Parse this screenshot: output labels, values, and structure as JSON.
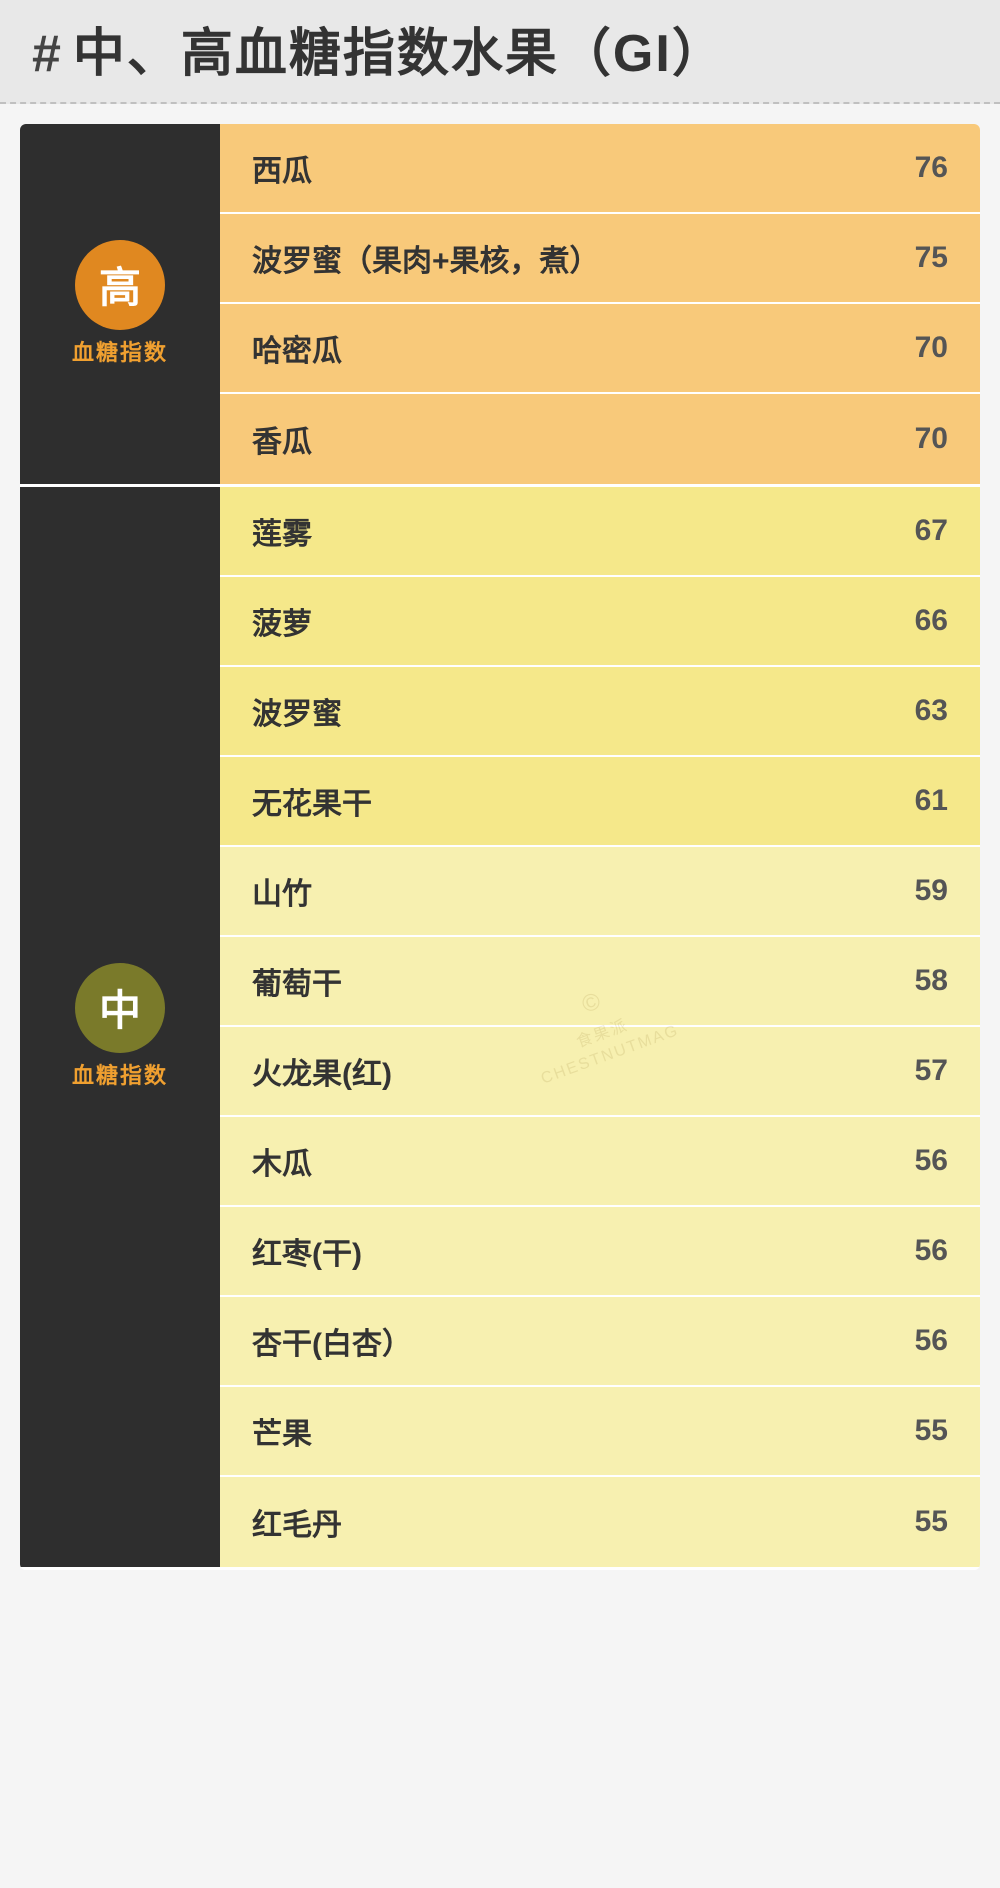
{
  "page": {
    "background": "#f5f5f5"
  },
  "header": {
    "hash": "#",
    "title": "中、高血糖指数水果（GI）"
  },
  "sections": [
    {
      "id": "high",
      "badge_type": "high",
      "badge_char": "高",
      "label": "血糖指数",
      "fruits": [
        {
          "name": "西瓜",
          "value": "76",
          "shade": "high-row"
        },
        {
          "name": "波罗蜜（果肉+果核，煮）",
          "value": "75",
          "shade": "high-row"
        },
        {
          "name": "哈密瓜",
          "value": "70",
          "shade": "high-row"
        },
        {
          "name": "香瓜",
          "value": "70",
          "shade": "high-row"
        }
      ]
    },
    {
      "id": "mid",
      "badge_type": "mid",
      "badge_char": "中",
      "label": "血糖指数",
      "fruits": [
        {
          "name": "莲雾",
          "value": "67",
          "shade": "mid-row-dark"
        },
        {
          "name": "菠萝",
          "value": "66",
          "shade": "mid-row-dark"
        },
        {
          "name": "波罗蜜",
          "value": "63",
          "shade": "mid-row-dark"
        },
        {
          "name": "无花果干",
          "value": "61",
          "shade": "mid-row-dark"
        },
        {
          "name": "山竹",
          "value": "59",
          "shade": "mid-row-light"
        },
        {
          "name": "葡萄干",
          "value": "58",
          "shade": "mid-row-light"
        },
        {
          "name": "火龙果(红)",
          "value": "57",
          "shade": "mid-row-light"
        },
        {
          "name": "木瓜",
          "value": "56",
          "shade": "mid-row-light"
        },
        {
          "name": "红枣(干)",
          "value": "56",
          "shade": "mid-row-light"
        },
        {
          "name": "杏干(白杏）",
          "value": "56",
          "shade": "mid-row-light"
        },
        {
          "name": "芒果",
          "value": "55",
          "shade": "mid-row-light"
        },
        {
          "name": "红毛丹",
          "value": "55",
          "shade": "mid-row-light"
        }
      ]
    }
  ],
  "watermark": {
    "circle": "©",
    "line1": "食果派",
    "line2": "CHESTNUTMAG"
  }
}
